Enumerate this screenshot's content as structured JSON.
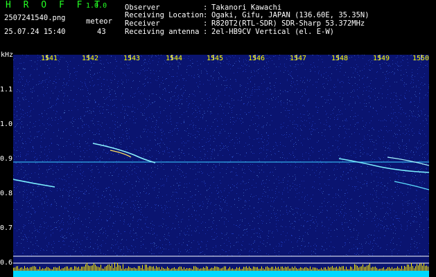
{
  "app": {
    "name": "H R O F F T",
    "version": "1.0.0"
  },
  "file": {
    "name": "2507241540.png",
    "datetime": "25.07.24 15:40"
  },
  "meteor": {
    "label": "meteor",
    "count": "43"
  },
  "info": [
    {
      "label": "Observer",
      "value": "Takanori Kawachi"
    },
    {
      "label": "Receiving Location",
      "value": "Ogaki, Gifu, JAPAN (136.60E, 35.35N)"
    },
    {
      "label": "Receiver",
      "value": "R820T2(RTL-SDR) SDR-Sharp 53.372MHz"
    },
    {
      "label": "Receiving antenna",
      "value": "2el-HB9CV Vertical (el. E-W)"
    }
  ],
  "axes": {
    "y_unit": "kHz",
    "y_ticks": [
      "1.1",
      "1.0",
      "0.9",
      "0.8",
      "0.7",
      "0.6"
    ],
    "x_ticks": [
      "1541",
      "1542",
      "1543",
      "1544",
      "1545",
      "1546",
      "1547",
      "1548",
      "1549",
      "1550"
    ]
  },
  "colors": {
    "accent_green": "#24ff24",
    "tick_yellow": "#ffff00",
    "background": "#0a1470",
    "signal": "#00e0ff"
  }
}
